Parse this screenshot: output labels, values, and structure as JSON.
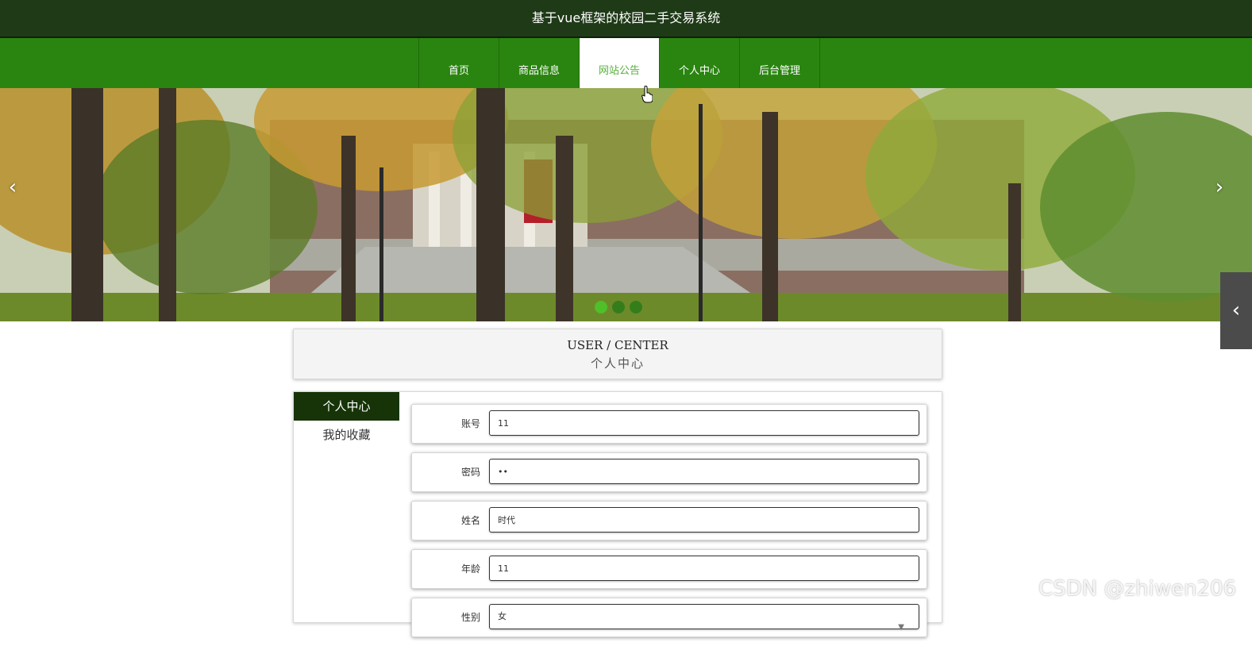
{
  "header": {
    "title": "基于vue框架的校园二手交易系统"
  },
  "nav": {
    "items": [
      {
        "label": "首页"
      },
      {
        "label": "商品信息"
      },
      {
        "label": "网站公告"
      },
      {
        "label": "个人中心"
      },
      {
        "label": "后台管理"
      }
    ],
    "active_label": "网站公告"
  },
  "carousel": {
    "prev_symbol": "‹",
    "next_symbol": "›",
    "slide_count": 3,
    "active_index": 0
  },
  "side_toggle": {
    "symbol": "‹"
  },
  "section": {
    "title_en": "USER / CENTER",
    "title_cn": "个人中心"
  },
  "menu": {
    "items": [
      {
        "label": "个人中心",
        "active": true
      },
      {
        "label": "我的收藏",
        "active": false
      }
    ]
  },
  "form": {
    "fields": [
      {
        "label": "账号",
        "value": "11"
      },
      {
        "label": "密码",
        "value": "••"
      },
      {
        "label": "姓名",
        "value": "时代"
      },
      {
        "label": "年龄",
        "value": "11"
      },
      {
        "label": "性别",
        "value": "女"
      }
    ]
  },
  "watermark": "CSDN @zhiwen206",
  "colors": {
    "topbar": "#1f3a17",
    "navbar": "#2a8510",
    "nav_active_text": "#57b13d",
    "menu_active_bg": "#163407",
    "dot_active": "#4fbf2a"
  }
}
